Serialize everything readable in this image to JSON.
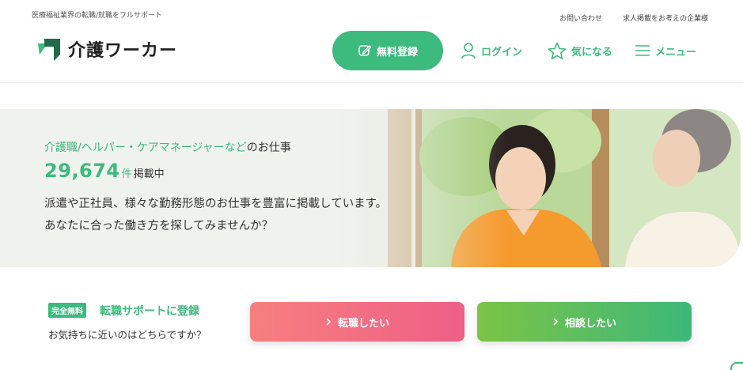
{
  "header": {
    "tagline": "医療福祉業界の転職/就職をフルサポート",
    "top_links": [
      "お問い合わせ",
      "求人掲載をお考えの企業様"
    ],
    "logo_text": "介護ワーカー",
    "nav": {
      "register": "無料登録",
      "login": "ログイン",
      "favorites": "気になる",
      "menu": "メニュー"
    }
  },
  "hero": {
    "jobs_prefix": "介護職/ヘルパー・ケアマネージャーなど",
    "jobs_suffix": "のお仕事",
    "count": "29,674",
    "count_unit": "件",
    "count_status": "掲載中",
    "desc_line1": "派遣や正社員、様々な勤務形態のお仕事を豊富に掲載しています。",
    "desc_line2": "あなたに合った働き方を探してみませんか？"
  },
  "cta": {
    "badge": "完全無料",
    "title": "転職サポートに登録",
    "question": "お気持ちに近いのはどちらですか？",
    "job_button": "転職したい",
    "consult_button": "相談したい"
  },
  "colors": {
    "brand_green": "#3dba7e",
    "job_button": "#f27083",
    "consult_button": "#5dbd60"
  },
  "icons": [
    "pen-icon",
    "user-icon",
    "star-icon",
    "menu-icon",
    "chevron-right-icon",
    "logo-mark-icon"
  ]
}
